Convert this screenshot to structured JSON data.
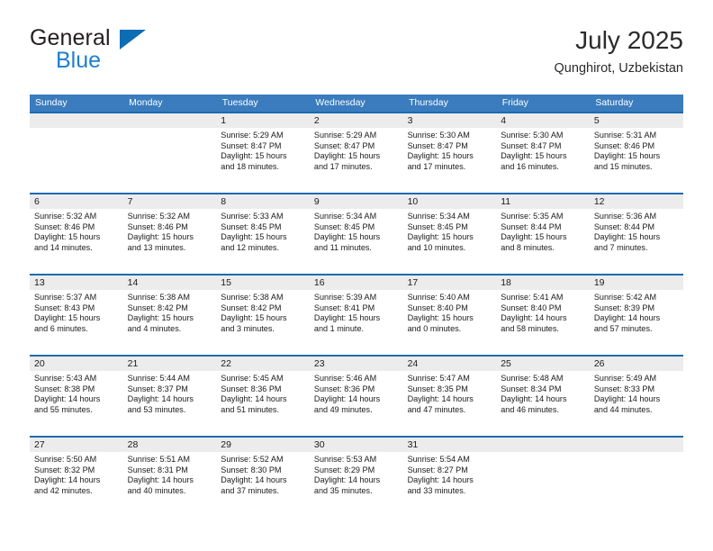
{
  "brand": {
    "name_part1": "General",
    "name_part2": "Blue",
    "triangle_color": "#0d6cb4",
    "blue_text_color": "#1c7fd0"
  },
  "header": {
    "title": "July 2025",
    "subtitle": "Qunghirot, Uzbekistan"
  },
  "theme": {
    "header_bar_color": "#3a7cbe",
    "week_divider_color": "#1c6bb0",
    "daynum_band_color": "#ececec"
  },
  "weekday_headers": [
    "Sunday",
    "Monday",
    "Tuesday",
    "Wednesday",
    "Thursday",
    "Friday",
    "Saturday"
  ],
  "labels": {
    "sunrise_prefix": "Sunrise:",
    "sunset_prefix": "Sunset:",
    "daylight_prefix": "Daylight:"
  },
  "weeks": [
    [
      {
        "day": "",
        "sunrise": "",
        "sunset": "",
        "daylight_line1": "",
        "daylight_line2": "",
        "empty": true
      },
      {
        "day": "",
        "sunrise": "",
        "sunset": "",
        "daylight_line1": "",
        "daylight_line2": "",
        "empty": true
      },
      {
        "day": "1",
        "sunrise": "Sunrise: 5:29 AM",
        "sunset": "Sunset: 8:47 PM",
        "daylight_line1": "Daylight: 15 hours",
        "daylight_line2": "and 18 minutes.",
        "empty": false
      },
      {
        "day": "2",
        "sunrise": "Sunrise: 5:29 AM",
        "sunset": "Sunset: 8:47 PM",
        "daylight_line1": "Daylight: 15 hours",
        "daylight_line2": "and 17 minutes.",
        "empty": false
      },
      {
        "day": "3",
        "sunrise": "Sunrise: 5:30 AM",
        "sunset": "Sunset: 8:47 PM",
        "daylight_line1": "Daylight: 15 hours",
        "daylight_line2": "and 17 minutes.",
        "empty": false
      },
      {
        "day": "4",
        "sunrise": "Sunrise: 5:30 AM",
        "sunset": "Sunset: 8:47 PM",
        "daylight_line1": "Daylight: 15 hours",
        "daylight_line2": "and 16 minutes.",
        "empty": false
      },
      {
        "day": "5",
        "sunrise": "Sunrise: 5:31 AM",
        "sunset": "Sunset: 8:46 PM",
        "daylight_line1": "Daylight: 15 hours",
        "daylight_line2": "and 15 minutes.",
        "empty": false
      }
    ],
    [
      {
        "day": "6",
        "sunrise": "Sunrise: 5:32 AM",
        "sunset": "Sunset: 8:46 PM",
        "daylight_line1": "Daylight: 15 hours",
        "daylight_line2": "and 14 minutes.",
        "empty": false
      },
      {
        "day": "7",
        "sunrise": "Sunrise: 5:32 AM",
        "sunset": "Sunset: 8:46 PM",
        "daylight_line1": "Daylight: 15 hours",
        "daylight_line2": "and 13 minutes.",
        "empty": false
      },
      {
        "day": "8",
        "sunrise": "Sunrise: 5:33 AM",
        "sunset": "Sunset: 8:45 PM",
        "daylight_line1": "Daylight: 15 hours",
        "daylight_line2": "and 12 minutes.",
        "empty": false
      },
      {
        "day": "9",
        "sunrise": "Sunrise: 5:34 AM",
        "sunset": "Sunset: 8:45 PM",
        "daylight_line1": "Daylight: 15 hours",
        "daylight_line2": "and 11 minutes.",
        "empty": false
      },
      {
        "day": "10",
        "sunrise": "Sunrise: 5:34 AM",
        "sunset": "Sunset: 8:45 PM",
        "daylight_line1": "Daylight: 15 hours",
        "daylight_line2": "and 10 minutes.",
        "empty": false
      },
      {
        "day": "11",
        "sunrise": "Sunrise: 5:35 AM",
        "sunset": "Sunset: 8:44 PM",
        "daylight_line1": "Daylight: 15 hours",
        "daylight_line2": "and 8 minutes.",
        "empty": false
      },
      {
        "day": "12",
        "sunrise": "Sunrise: 5:36 AM",
        "sunset": "Sunset: 8:44 PM",
        "daylight_line1": "Daylight: 15 hours",
        "daylight_line2": "and 7 minutes.",
        "empty": false
      }
    ],
    [
      {
        "day": "13",
        "sunrise": "Sunrise: 5:37 AM",
        "sunset": "Sunset: 8:43 PM",
        "daylight_line1": "Daylight: 15 hours",
        "daylight_line2": "and 6 minutes.",
        "empty": false
      },
      {
        "day": "14",
        "sunrise": "Sunrise: 5:38 AM",
        "sunset": "Sunset: 8:42 PM",
        "daylight_line1": "Daylight: 15 hours",
        "daylight_line2": "and 4 minutes.",
        "empty": false
      },
      {
        "day": "15",
        "sunrise": "Sunrise: 5:38 AM",
        "sunset": "Sunset: 8:42 PM",
        "daylight_line1": "Daylight: 15 hours",
        "daylight_line2": "and 3 minutes.",
        "empty": false
      },
      {
        "day": "16",
        "sunrise": "Sunrise: 5:39 AM",
        "sunset": "Sunset: 8:41 PM",
        "daylight_line1": "Daylight: 15 hours",
        "daylight_line2": "and 1 minute.",
        "empty": false
      },
      {
        "day": "17",
        "sunrise": "Sunrise: 5:40 AM",
        "sunset": "Sunset: 8:40 PM",
        "daylight_line1": "Daylight: 15 hours",
        "daylight_line2": "and 0 minutes.",
        "empty": false
      },
      {
        "day": "18",
        "sunrise": "Sunrise: 5:41 AM",
        "sunset": "Sunset: 8:40 PM",
        "daylight_line1": "Daylight: 14 hours",
        "daylight_line2": "and 58 minutes.",
        "empty": false
      },
      {
        "day": "19",
        "sunrise": "Sunrise: 5:42 AM",
        "sunset": "Sunset: 8:39 PM",
        "daylight_line1": "Daylight: 14 hours",
        "daylight_line2": "and 57 minutes.",
        "empty": false
      }
    ],
    [
      {
        "day": "20",
        "sunrise": "Sunrise: 5:43 AM",
        "sunset": "Sunset: 8:38 PM",
        "daylight_line1": "Daylight: 14 hours",
        "daylight_line2": "and 55 minutes.",
        "empty": false
      },
      {
        "day": "21",
        "sunrise": "Sunrise: 5:44 AM",
        "sunset": "Sunset: 8:37 PM",
        "daylight_line1": "Daylight: 14 hours",
        "daylight_line2": "and 53 minutes.",
        "empty": false
      },
      {
        "day": "22",
        "sunrise": "Sunrise: 5:45 AM",
        "sunset": "Sunset: 8:36 PM",
        "daylight_line1": "Daylight: 14 hours",
        "daylight_line2": "and 51 minutes.",
        "empty": false
      },
      {
        "day": "23",
        "sunrise": "Sunrise: 5:46 AM",
        "sunset": "Sunset: 8:36 PM",
        "daylight_line1": "Daylight: 14 hours",
        "daylight_line2": "and 49 minutes.",
        "empty": false
      },
      {
        "day": "24",
        "sunrise": "Sunrise: 5:47 AM",
        "sunset": "Sunset: 8:35 PM",
        "daylight_line1": "Daylight: 14 hours",
        "daylight_line2": "and 47 minutes.",
        "empty": false
      },
      {
        "day": "25",
        "sunrise": "Sunrise: 5:48 AM",
        "sunset": "Sunset: 8:34 PM",
        "daylight_line1": "Daylight: 14 hours",
        "daylight_line2": "and 46 minutes.",
        "empty": false
      },
      {
        "day": "26",
        "sunrise": "Sunrise: 5:49 AM",
        "sunset": "Sunset: 8:33 PM",
        "daylight_line1": "Daylight: 14 hours",
        "daylight_line2": "and 44 minutes.",
        "empty": false
      }
    ],
    [
      {
        "day": "27",
        "sunrise": "Sunrise: 5:50 AM",
        "sunset": "Sunset: 8:32 PM",
        "daylight_line1": "Daylight: 14 hours",
        "daylight_line2": "and 42 minutes.",
        "empty": false
      },
      {
        "day": "28",
        "sunrise": "Sunrise: 5:51 AM",
        "sunset": "Sunset: 8:31 PM",
        "daylight_line1": "Daylight: 14 hours",
        "daylight_line2": "and 40 minutes.",
        "empty": false
      },
      {
        "day": "29",
        "sunrise": "Sunrise: 5:52 AM",
        "sunset": "Sunset: 8:30 PM",
        "daylight_line1": "Daylight: 14 hours",
        "daylight_line2": "and 37 minutes.",
        "empty": false
      },
      {
        "day": "30",
        "sunrise": "Sunrise: 5:53 AM",
        "sunset": "Sunset: 8:29 PM",
        "daylight_line1": "Daylight: 14 hours",
        "daylight_line2": "and 35 minutes.",
        "empty": false
      },
      {
        "day": "31",
        "sunrise": "Sunrise: 5:54 AM",
        "sunset": "Sunset: 8:27 PM",
        "daylight_line1": "Daylight: 14 hours",
        "daylight_line2": "and 33 minutes.",
        "empty": false
      },
      {
        "day": "",
        "sunrise": "",
        "sunset": "",
        "daylight_line1": "",
        "daylight_line2": "",
        "empty": true
      },
      {
        "day": "",
        "sunrise": "",
        "sunset": "",
        "daylight_line1": "",
        "daylight_line2": "",
        "empty": true
      }
    ]
  ]
}
